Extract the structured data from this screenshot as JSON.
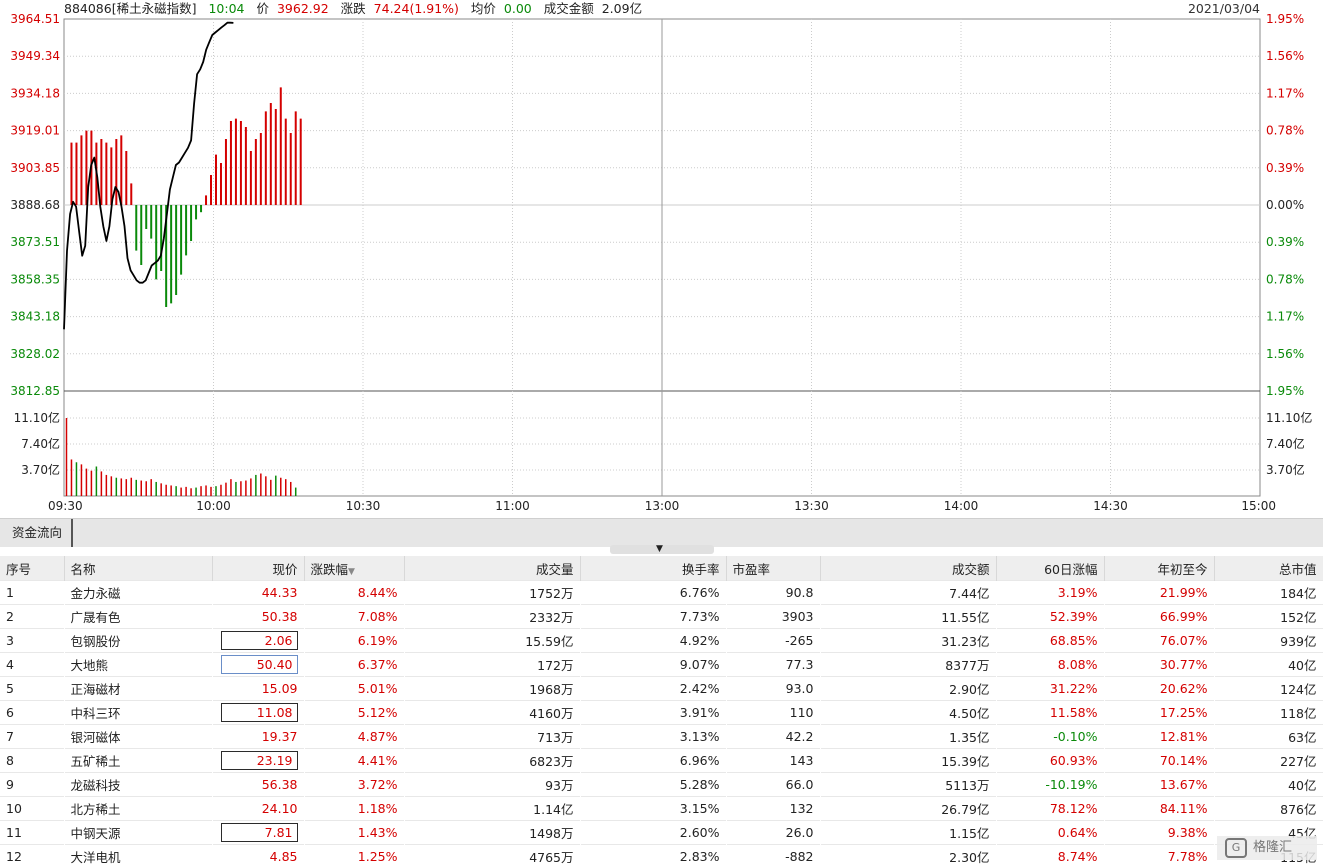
{
  "header": {
    "code_name": "884086[稀土永磁指数]",
    "time": "10:04",
    "price_label": "价",
    "price": "3962.92",
    "change_label": "涨跌",
    "change": "74.24(1.91%)",
    "avg_label": "均价",
    "avg": "0.00",
    "turnover_label": "成交金额",
    "turnover": "2.09亿",
    "date": "2021/03/04"
  },
  "colors": {
    "up": "#d40000",
    "down": "#0a8a0a",
    "line": "#000000",
    "grid": "#cccccc",
    "grid_major": "#888888"
  },
  "chart_data": {
    "type": "line",
    "title": "",
    "base": 3888.68,
    "y_ticks": [
      "3964.51",
      "3949.34",
      "3934.18",
      "3919.01",
      "3903.85",
      "3888.68",
      "3873.51",
      "3858.35",
      "3843.18",
      "3828.02",
      "3812.85"
    ],
    "pct_ticks": [
      "1.95%",
      "1.56%",
      "1.17%",
      "0.78%",
      "0.39%",
      "0.00%",
      "0.39%",
      "0.78%",
      "1.17%",
      "1.56%",
      "1.95%"
    ],
    "vol_ticks": [
      "11.10亿",
      "7.40亿",
      "3.70亿"
    ],
    "x_ticks": [
      "09:30",
      "10:00",
      "10:30",
      "11:00",
      "13:00",
      "13:30",
      "14:00",
      "14:30",
      "15:00"
    ],
    "ylim": [
      3812.85,
      3964.51
    ],
    "minutes": 240,
    "price": [
      3838,
      3870,
      3885,
      3890,
      3888,
      3878,
      3868,
      3872,
      3896,
      3905,
      3908,
      3900,
      3888,
      3880,
      3874,
      3880,
      3891,
      3896,
      3894,
      3888,
      3880,
      3867,
      3862,
      3860,
      3858,
      3857,
      3857,
      3858,
      3861,
      3864,
      3865,
      3866,
      3868,
      3875,
      3885,
      3895,
      3900,
      3905,
      3906,
      3908,
      3910,
      3912,
      3915,
      3930,
      3942,
      3944,
      3947,
      3952,
      3955,
      3958,
      3959,
      3960,
      3961,
      3962,
      3963,
      3963,
      3962.92
    ],
    "bars": [
      0.52,
      0.52,
      0.58,
      0.62,
      0.62,
      0.52,
      0.55,
      0.52,
      0.48,
      0.55,
      0.58,
      0.45,
      0.18,
      -0.38,
      -0.5,
      -0.2,
      -0.28,
      -0.62,
      -0.55,
      -0.85,
      -0.82,
      -0.75,
      -0.58,
      -0.42,
      -0.3,
      -0.12,
      -0.06,
      0.08,
      0.25,
      0.42,
      0.35,
      0.55,
      0.7,
      0.72,
      0.7,
      0.65,
      0.45,
      0.55,
      0.6,
      0.78,
      0.85,
      0.8,
      0.98,
      0.72,
      0.6,
      0.78,
      0.72
    ],
    "volume": [
      11.1,
      5.2,
      4.8,
      4.5,
      3.9,
      3.6,
      4.2,
      3.5,
      3.0,
      2.8,
      2.6,
      2.5,
      2.4,
      2.6,
      2.3,
      2.2,
      2.1,
      2.4,
      2.0,
      1.8,
      1.6,
      1.5,
      1.4,
      1.2,
      1.3,
      1.1,
      1.2,
      1.4,
      1.5,
      1.3,
      1.4,
      1.6,
      1.9,
      2.4,
      2.0,
      2.1,
      2.2,
      2.5,
      3.0,
      3.2,
      2.8,
      2.3,
      2.9,
      2.6,
      2.4,
      2.0,
      1.2
    ]
  },
  "tab": {
    "label": "资金流向"
  },
  "table": {
    "columns": [
      "序号",
      "名称",
      "现价",
      "涨跌幅",
      "成交量",
      "换手率",
      "市盈率",
      "成交额",
      "60日涨幅",
      "年初至今",
      "总市值"
    ],
    "rows": [
      {
        "no": "1",
        "name": "金力永磁",
        "price": "44.33",
        "chg": "8.44%",
        "vol": "1752万",
        "turnover_rate": "6.76%",
        "pe": "90.8",
        "amount": "7.44亿",
        "d60": "3.19%",
        "ytd": "21.99%",
        "mcap": "184亿"
      },
      {
        "no": "2",
        "name": "广晟有色",
        "price": "50.38",
        "chg": "7.08%",
        "vol": "2332万",
        "turnover_rate": "7.73%",
        "pe": "3903",
        "amount": "11.55亿",
        "d60": "52.39%",
        "ytd": "66.99%",
        "mcap": "152亿"
      },
      {
        "no": "3",
        "name": "包钢股份",
        "price": "2.06",
        "chg": "6.19%",
        "vol": "15.59亿",
        "turnover_rate": "4.92%",
        "pe": "-265",
        "amount": "31.23亿",
        "d60": "68.85%",
        "ytd": "76.07%",
        "mcap": "939亿"
      },
      {
        "no": "4",
        "name": "大地熊",
        "price": "50.40",
        "chg": "6.37%",
        "vol": "172万",
        "turnover_rate": "9.07%",
        "pe": "77.3",
        "amount": "8377万",
        "d60": "8.08%",
        "ytd": "30.77%",
        "mcap": "40亿"
      },
      {
        "no": "5",
        "name": "正海磁材",
        "price": "15.09",
        "chg": "5.01%",
        "vol": "1968万",
        "turnover_rate": "2.42%",
        "pe": "93.0",
        "amount": "2.90亿",
        "d60": "31.22%",
        "ytd": "20.62%",
        "mcap": "124亿"
      },
      {
        "no": "6",
        "name": "中科三环",
        "price": "11.08",
        "chg": "5.12%",
        "vol": "4160万",
        "turnover_rate": "3.91%",
        "pe": "110",
        "amount": "4.50亿",
        "d60": "11.58%",
        "ytd": "17.25%",
        "mcap": "118亿"
      },
      {
        "no": "7",
        "name": "银河磁体",
        "price": "19.37",
        "chg": "4.87%",
        "vol": "713万",
        "turnover_rate": "3.13%",
        "pe": "42.2",
        "amount": "1.35亿",
        "d60": "-0.10%",
        "ytd": "12.81%",
        "mcap": "63亿"
      },
      {
        "no": "8",
        "name": "五矿稀土",
        "price": "23.19",
        "chg": "4.41%",
        "vol": "6823万",
        "turnover_rate": "6.96%",
        "pe": "143",
        "amount": "15.39亿",
        "d60": "60.93%",
        "ytd": "70.14%",
        "mcap": "227亿"
      },
      {
        "no": "9",
        "name": "龙磁科技",
        "price": "56.38",
        "chg": "3.72%",
        "vol": "93万",
        "turnover_rate": "5.28%",
        "pe": "66.0",
        "amount": "5113万",
        "d60": "-10.19%",
        "ytd": "13.67%",
        "mcap": "40亿"
      },
      {
        "no": "10",
        "name": "北方稀土",
        "price": "24.10",
        "chg": "1.18%",
        "vol": "1.14亿",
        "turnover_rate": "3.15%",
        "pe": "132",
        "amount": "26.79亿",
        "d60": "78.12%",
        "ytd": "84.11%",
        "mcap": "876亿"
      },
      {
        "no": "11",
        "name": "中钢天源",
        "price": "7.81",
        "chg": "1.43%",
        "vol": "1498万",
        "turnover_rate": "2.60%",
        "pe": "26.0",
        "amount": "1.15亿",
        "d60": "0.64%",
        "ytd": "9.38%",
        "mcap": "45亿"
      },
      {
        "no": "12",
        "name": "大洋电机",
        "price": "4.85",
        "chg": "1.25%",
        "vol": "4765万",
        "turnover_rate": "2.83%",
        "pe": "-882",
        "amount": "2.30亿",
        "d60": "8.74%",
        "ytd": "7.78%",
        "mcap": "115亿"
      }
    ]
  },
  "watermark": {
    "text": "格隆汇"
  }
}
